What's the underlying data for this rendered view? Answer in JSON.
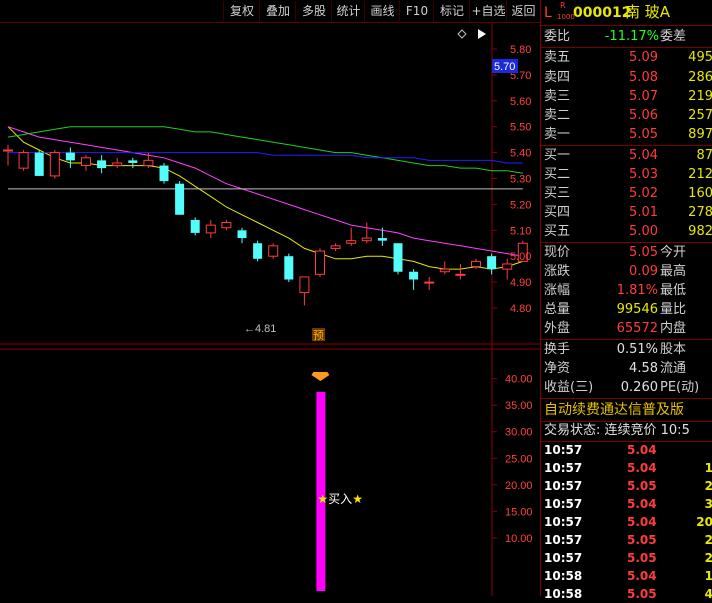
{
  "toolbar": {
    "buttons": [
      "复权",
      "叠加",
      "多股",
      "统计",
      "画线",
      "F10",
      "标记",
      "+自选",
      "返回"
    ]
  },
  "chart": {
    "price_axis": [
      "5.80",
      "5.70",
      "5.60",
      "5.50",
      "5.40",
      "5.30",
      "5.20",
      "5.10",
      "5.00",
      "4.90",
      "4.80"
    ],
    "current_price_tag": "5.70",
    "low_label": "4.81",
    "preview_badge": "预",
    "indicator_axis": [
      "40.00",
      "35.00",
      "30.00",
      "25.00",
      "20.00",
      "15.00",
      "10.00"
    ],
    "buy_signal": "★买入★",
    "colors": {
      "up": "#ff3c3c",
      "down": "#54fcfc",
      "ma5": "#ffffff",
      "ma10": "#e8e800",
      "ma20": "#ff40ff",
      "ma30": "#20d020",
      "ma60": "#2020ff",
      "ma120": "#c0c0c0",
      "signal_bar": "#ff00ff"
    }
  },
  "chart_data": {
    "type": "candlestick",
    "ylim": [
      4.76,
      5.86
    ],
    "candles": [
      {
        "o": 5.41,
        "c": 5.41,
        "h": 5.43,
        "l": 5.35
      },
      {
        "o": 5.34,
        "c": 5.4,
        "h": 5.41,
        "l": 5.33
      },
      {
        "o": 5.4,
        "c": 5.31,
        "h": 5.41,
        "l": 5.31
      },
      {
        "o": 5.31,
        "c": 5.4,
        "h": 5.41,
        "l": 5.3
      },
      {
        "o": 5.4,
        "c": 5.37,
        "h": 5.42,
        "l": 5.34
      },
      {
        "o": 5.35,
        "c": 5.38,
        "h": 5.39,
        "l": 5.33
      },
      {
        "o": 5.37,
        "c": 5.34,
        "h": 5.39,
        "l": 5.32
      },
      {
        "o": 5.35,
        "c": 5.36,
        "h": 5.38,
        "l": 5.34
      },
      {
        "o": 5.37,
        "c": 5.36,
        "h": 5.38,
        "l": 5.34
      },
      {
        "o": 5.35,
        "c": 5.37,
        "h": 5.4,
        "l": 5.34
      },
      {
        "o": 5.35,
        "c": 5.29,
        "h": 5.36,
        "l": 5.28
      },
      {
        "o": 5.28,
        "c": 5.16,
        "h": 5.29,
        "l": 5.16
      },
      {
        "o": 5.14,
        "c": 5.09,
        "h": 5.15,
        "l": 5.08
      },
      {
        "o": 5.09,
        "c": 5.12,
        "h": 5.14,
        "l": 5.07
      },
      {
        "o": 5.11,
        "c": 5.13,
        "h": 5.14,
        "l": 5.1
      },
      {
        "o": 5.1,
        "c": 5.07,
        "h": 5.11,
        "l": 5.05
      },
      {
        "o": 5.05,
        "c": 4.99,
        "h": 5.06,
        "l": 4.98
      },
      {
        "o": 5.0,
        "c": 5.04,
        "h": 5.05,
        "l": 4.99
      },
      {
        "o": 5.0,
        "c": 4.91,
        "h": 5.01,
        "l": 4.9
      },
      {
        "o": 4.86,
        "c": 4.92,
        "h": 4.92,
        "l": 4.81
      },
      {
        "o": 4.93,
        "c": 5.02,
        "h": 5.03,
        "l": 4.92
      },
      {
        "o": 5.03,
        "c": 5.04,
        "h": 5.05,
        "l": 5.02
      },
      {
        "o": 5.05,
        "c": 5.06,
        "h": 5.11,
        "l": 5.04
      },
      {
        "o": 5.06,
        "c": 5.07,
        "h": 5.13,
        "l": 5.05
      },
      {
        "o": 5.07,
        "c": 5.06,
        "h": 5.11,
        "l": 5.04
      },
      {
        "o": 5.05,
        "c": 4.94,
        "h": 5.05,
        "l": 4.93
      },
      {
        "o": 4.94,
        "c": 4.91,
        "h": 4.95,
        "l": 4.87
      },
      {
        "o": 4.9,
        "c": 4.9,
        "h": 4.92,
        "l": 4.87
      },
      {
        "o": 4.94,
        "c": 4.95,
        "h": 4.98,
        "l": 4.93
      },
      {
        "o": 4.93,
        "c": 4.93,
        "h": 4.97,
        "l": 4.91
      },
      {
        "o": 4.96,
        "c": 4.98,
        "h": 4.99,
        "l": 4.95
      },
      {
        "o": 5.0,
        "c": 4.95,
        "h": 5.01,
        "l": 4.93
      },
      {
        "o": 4.95,
        "c": 4.97,
        "h": 4.99,
        "l": 4.91
      },
      {
        "o": 4.98,
        "c": 5.05,
        "h": 5.06,
        "l": 4.98
      }
    ],
    "ma_lines": [
      {
        "name": "ma10",
        "values": [
          5.5,
          5.44,
          5.41,
          5.38,
          5.36,
          5.36,
          5.35,
          5.35,
          5.35,
          5.35,
          5.34,
          5.31,
          5.27,
          5.23,
          5.19,
          5.16,
          5.13,
          5.1,
          5.07,
          5.03,
          5.01,
          4.99,
          4.99,
          5.0,
          5.0,
          4.99,
          4.98,
          4.96,
          4.95,
          4.95,
          4.96,
          4.95,
          4.96,
          4.98
        ]
      },
      {
        "name": "ma20",
        "values": [
          5.5,
          5.48,
          5.46,
          5.45,
          5.44,
          5.43,
          5.42,
          5.41,
          5.4,
          5.39,
          5.38,
          5.36,
          5.34,
          5.31,
          5.28,
          5.26,
          5.24,
          5.22,
          5.2,
          5.18,
          5.16,
          5.14,
          5.12,
          5.11,
          5.1,
          5.09,
          5.07,
          5.06,
          5.05,
          5.04,
          5.03,
          5.02,
          5.01,
          5.0
        ]
      },
      {
        "name": "ma30",
        "values": [
          5.46,
          5.47,
          5.48,
          5.49,
          5.5,
          5.5,
          5.5,
          5.5,
          5.5,
          5.5,
          5.5,
          5.49,
          5.48,
          5.48,
          5.47,
          5.46,
          5.45,
          5.44,
          5.43,
          5.42,
          5.41,
          5.4,
          5.4,
          5.39,
          5.38,
          5.37,
          5.36,
          5.35,
          5.35,
          5.34,
          5.34,
          5.33,
          5.33,
          5.32
        ]
      },
      {
        "name": "ma60",
        "values": [
          5.4,
          5.4,
          5.4,
          5.4,
          5.4,
          5.4,
          5.4,
          5.4,
          5.4,
          5.4,
          5.4,
          5.4,
          5.4,
          5.4,
          5.4,
          5.4,
          5.4,
          5.39,
          5.39,
          5.39,
          5.39,
          5.39,
          5.39,
          5.38,
          5.38,
          5.38,
          5.38,
          5.37,
          5.37,
          5.37,
          5.37,
          5.37,
          5.36,
          5.36
        ]
      },
      {
        "name": "ma120",
        "values": [
          5.26,
          5.26,
          5.26,
          5.26,
          5.26,
          5.26,
          5.26,
          5.26,
          5.26,
          5.26,
          5.26,
          5.26,
          5.26,
          5.26,
          5.26,
          5.26,
          5.26,
          5.26,
          5.26,
          5.26,
          5.26,
          5.26,
          5.26,
          5.26,
          5.26,
          5.26,
          5.26,
          5.26,
          5.26,
          5.26,
          5.26,
          5.26,
          5.26,
          5.26
        ]
      }
    ],
    "signal": {
      "candle_index": 19,
      "value": 37.5,
      "ylim": [
        0,
        42
      ]
    }
  },
  "quote": {
    "code_prefix": "L",
    "badge_top": "R",
    "badge_bottom": "1000",
    "code": "000012",
    "name": "南 玻A",
    "ratio": {
      "label": "委比",
      "value": "-11.17%",
      "label2": "委差"
    },
    "asks": [
      {
        "label": "卖五",
        "price": "5.09",
        "vol": "495"
      },
      {
        "label": "卖四",
        "price": "5.08",
        "vol": "286"
      },
      {
        "label": "卖三",
        "price": "5.07",
        "vol": "219"
      },
      {
        "label": "卖二",
        "price": "5.06",
        "vol": "257"
      },
      {
        "label": "卖一",
        "price": "5.05",
        "vol": "897"
      }
    ],
    "bids": [
      {
        "label": "买一",
        "price": "5.04",
        "vol": "87"
      },
      {
        "label": "买二",
        "price": "5.03",
        "vol": "212"
      },
      {
        "label": "买三",
        "price": "5.02",
        "vol": "160"
      },
      {
        "label": "买四",
        "price": "5.01",
        "vol": "278"
      },
      {
        "label": "买五",
        "price": "5.00",
        "vol": "982"
      }
    ],
    "stats": [
      {
        "label": "现价",
        "value": "5.05",
        "label2": "今开",
        "cls": "red"
      },
      {
        "label": "涨跌",
        "value": "0.09",
        "label2": "最高",
        "cls": "red"
      },
      {
        "label": "涨幅",
        "value": "1.81%",
        "label2": "最低",
        "cls": "red"
      },
      {
        "label": "总量",
        "value": "99546",
        "label2": "量比",
        "cls": "yellow"
      },
      {
        "label": "外盘",
        "value": "65572",
        "label2": "内盘",
        "cls": "red"
      }
    ],
    "fund": [
      {
        "label": "换手",
        "value": "0.51%",
        "label2": "股本"
      },
      {
        "label": "净资",
        "value": "4.58",
        "label2": "流通"
      },
      {
        "label": "收益(三)",
        "value": "0.260",
        "label2": "PE(动)"
      }
    ],
    "banner": "自动续费通达信普及版",
    "status": "交易状态: 连续竞价 10:5",
    "ticks": [
      {
        "time": "10:57",
        "price": "5.04",
        "vol": ""
      },
      {
        "time": "10:57",
        "price": "5.04",
        "vol": "1"
      },
      {
        "time": "10:57",
        "price": "5.05",
        "vol": "2"
      },
      {
        "time": "10:57",
        "price": "5.04",
        "vol": "3"
      },
      {
        "time": "10:57",
        "price": "5.04",
        "vol": "20"
      },
      {
        "time": "10:57",
        "price": "5.05",
        "vol": "2"
      },
      {
        "time": "10:57",
        "price": "5.05",
        "vol": "2"
      },
      {
        "time": "10:58",
        "price": "5.04",
        "vol": "1"
      },
      {
        "time": "10:58",
        "price": "5.05",
        "vol": "4"
      }
    ]
  }
}
